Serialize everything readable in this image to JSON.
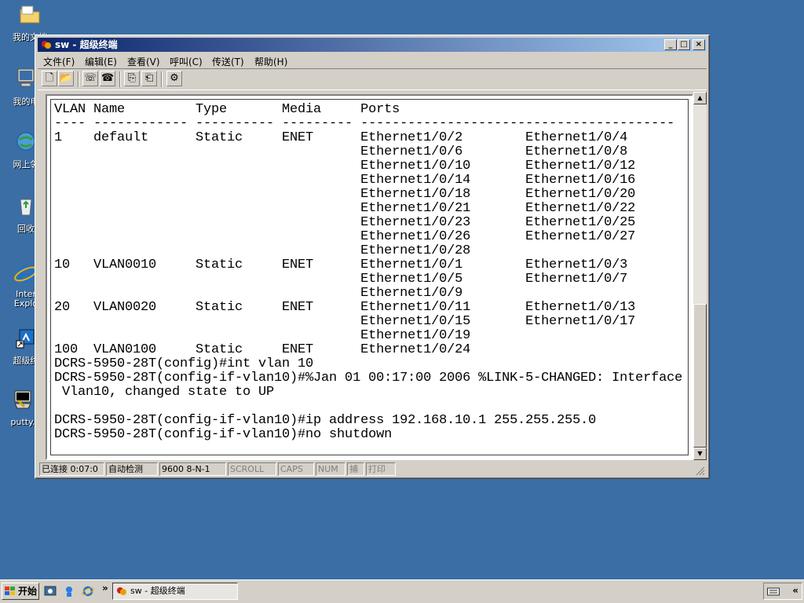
{
  "desktop": {
    "icons": [
      {
        "label": "我的文档",
        "icon": "folder-icon"
      },
      {
        "label": "我的电",
        "icon": "computer-icon"
      },
      {
        "label": "网上邻",
        "icon": "network-icon"
      },
      {
        "label": "回收",
        "icon": "recycle-bin-icon"
      },
      {
        "label": "Inter Explo",
        "icon": "ie-icon"
      },
      {
        "label": "超级终",
        "icon": "hyperterminal-icon"
      },
      {
        "label": "putty.",
        "icon": "putty-icon"
      }
    ]
  },
  "window": {
    "title": "sw - 超级终端",
    "controls": {
      "minimize": "_",
      "maximize": "□",
      "close": "×"
    },
    "menu": [
      "文件(F)",
      "编辑(E)",
      "查看(V)",
      "呼叫(C)",
      "传送(T)",
      "帮助(H)"
    ],
    "toolbar": [
      {
        "name": "new-icon",
        "glyph": "🗋"
      },
      {
        "name": "open-icon",
        "glyph": "📂"
      },
      {
        "name": "connect-icon",
        "glyph": "☏"
      },
      {
        "name": "disconnect-icon",
        "glyph": "☎"
      },
      {
        "name": "send-icon",
        "glyph": "⎘"
      },
      {
        "name": "receive-icon",
        "glyph": "⎗"
      },
      {
        "name": "properties-icon",
        "glyph": "⚙"
      }
    ],
    "terminal_lines": [
      "VLAN Name         Type       Media     Ports",
      "---- ------------ ---------- --------- ----------------------------------------",
      "1    default      Static     ENET      Ethernet1/0/2        Ethernet1/0/4",
      "                                       Ethernet1/0/6        Ethernet1/0/8",
      "                                       Ethernet1/0/10       Ethernet1/0/12",
      "                                       Ethernet1/0/14       Ethernet1/0/16",
      "                                       Ethernet1/0/18       Ethernet1/0/20",
      "                                       Ethernet1/0/21       Ethernet1/0/22",
      "                                       Ethernet1/0/23       Ethernet1/0/25",
      "                                       Ethernet1/0/26       Ethernet1/0/27",
      "                                       Ethernet1/0/28",
      "10   VLAN0010     Static     ENET      Ethernet1/0/1        Ethernet1/0/3",
      "                                       Ethernet1/0/5        Ethernet1/0/7",
      "                                       Ethernet1/0/9",
      "20   VLAN0020     Static     ENET      Ethernet1/0/11       Ethernet1/0/13",
      "                                       Ethernet1/0/15       Ethernet1/0/17",
      "                                       Ethernet1/0/19",
      "100  VLAN0100     Static     ENET      Ethernet1/0/24",
      "DCRS-5950-28T(config)#int vlan 10",
      "DCRS-5950-28T(config-if-vlan10)#%Jan 01 00:17:00 2006 %LINK-5-CHANGED: Interface",
      " Vlan10, changed state to UP",
      "",
      "DCRS-5950-28T(config-if-vlan10)#ip address 192.168.10.1 255.255.255.0",
      "DCRS-5950-28T(config-if-vlan10)#no shutdown"
    ],
    "status": {
      "connected": "已连接 0:07:0",
      "detect": "自动检测",
      "serial": "9600 8-N-1",
      "scroll": "SCROLL",
      "caps": "CAPS",
      "num": "NUM",
      "capture": "捕",
      "print": "打印"
    }
  },
  "taskbar": {
    "start_label": "开始",
    "task_label": "sw - 超级终端",
    "chevron": "»",
    "tray_chevron": "«"
  }
}
